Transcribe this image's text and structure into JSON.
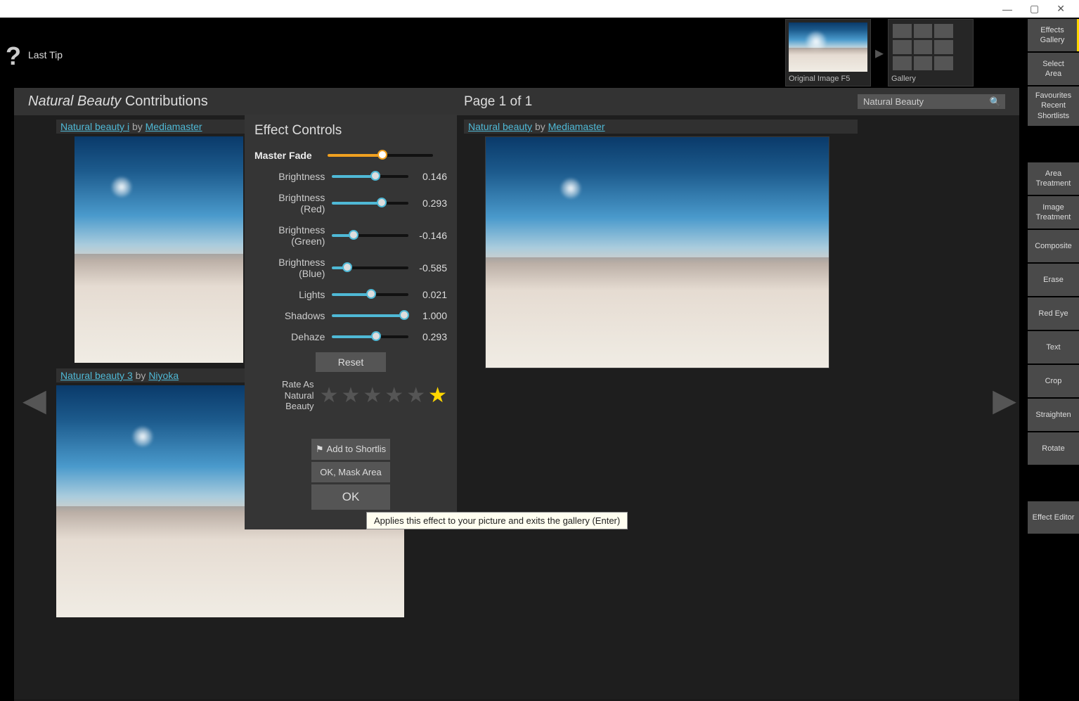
{
  "window": {
    "min": "—",
    "max": "▢",
    "close": "✕"
  },
  "top": {
    "last_tip": "Last Tip",
    "orig_label": "Original Image F5",
    "gallery_label": "Gallery"
  },
  "rail": {
    "effects": "Effects\nGallery",
    "select": "Select\nArea",
    "fav": "Favourites\nRecent\nShortlists",
    "area": "Area\nTreatment",
    "image": "Image\nTreatment",
    "composite": "Composite",
    "erase": "Erase",
    "redeye": "Red Eye",
    "text": "Text",
    "crop": "Crop",
    "straighten": "Straighten",
    "rotate": "Rotate",
    "editor": "Effect Editor"
  },
  "header": {
    "title_italic": "Natural Beauty",
    "title_rest": " Contributions",
    "page": "Page 1 of 1",
    "search": "Natural Beauty"
  },
  "items": {
    "i1_name": "Natural beauty i",
    "i1_by": " by ",
    "i1_author": "Mediamaster",
    "i2_name": "Natural beauty",
    "i2_by": " by ",
    "i2_author": "Mediamaster",
    "i3_name": "Natural beauty 3",
    "i3_by": " by ",
    "i3_author": "Niyoka"
  },
  "panel": {
    "title": "Effect Controls",
    "master": "Master Fade",
    "sliders": [
      {
        "label": "Brightness",
        "value": "0.146",
        "pct": 57
      },
      {
        "label": "Brightness (Red)",
        "value": "0.293",
        "pct": 65
      },
      {
        "label": "Brightness (Green)",
        "value": "-0.146",
        "pct": 28
      },
      {
        "label": "Brightness (Blue)",
        "value": "-0.585",
        "pct": 20
      },
      {
        "label": "Lights",
        "value": "0.021",
        "pct": 51
      },
      {
        "label": "Shadows",
        "value": "1.000",
        "pct": 95
      },
      {
        "label": "Dehaze",
        "value": "0.293",
        "pct": 58
      }
    ],
    "reset": "Reset",
    "rate1": "Rate As",
    "rate2": "Natural Beauty",
    "shortlist": "Add to Shortlis",
    "mask": "OK, Mask Area",
    "ok": "OK"
  },
  "tooltip": "Applies this effect to your picture and exits the gallery (Enter)"
}
